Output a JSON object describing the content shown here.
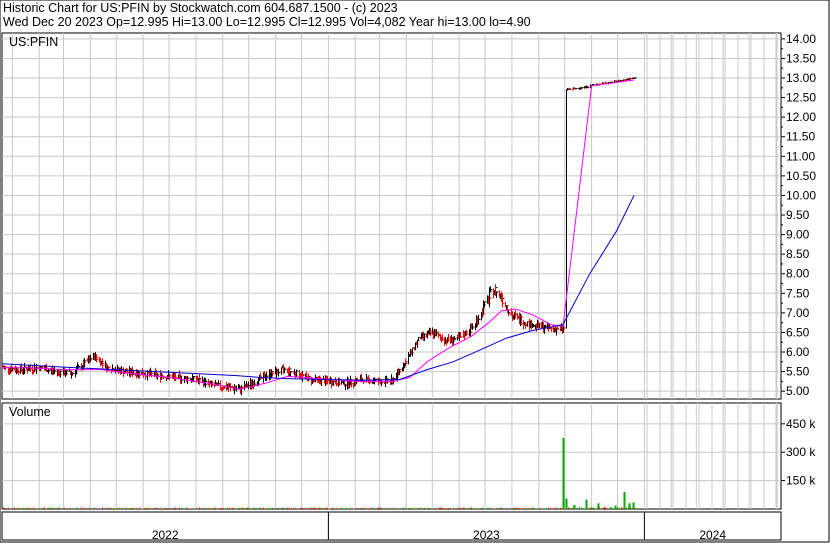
{
  "header": {
    "line1": "Historic Chart for US:PFIN by Stockwatch.com 604.687.1500 - (c) 2023",
    "line2": "Wed Dec 20 2023   Op=12.995   Hi=13.00   Lo=12.995   Cl=12.995   Vol=4,082   Year hi=13.00   lo=4.90"
  },
  "price_panel": {
    "label": "US:PFIN"
  },
  "volume_panel": {
    "label": "Volume"
  },
  "colors": {
    "up_bar": "#000000",
    "down_bar": "#ff0000",
    "short_ma": "#ff00ff",
    "long_ma": "#0000cc",
    "volume_up": "#00aa00",
    "volume_down": "#ff0000",
    "grid": "#c8c8c8",
    "axis": "#000000"
  },
  "chart_data": [
    {
      "type": "line",
      "title": "US:PFIN",
      "yaxis_ticks": [
        "14.00",
        "13.50",
        "13.00",
        "12.50",
        "12.00",
        "11.50",
        "11.00",
        "10.50",
        "10.00",
        "9.50",
        "9.00",
        "8.50",
        "8.00",
        "7.50",
        "7.00",
        "6.50",
        "6.00",
        "5.50",
        "5.00"
      ],
      "ylim": [
        4.8,
        14.15
      ],
      "xlim": [
        "2021-12-20",
        "2023-12-20"
      ],
      "x_axis_labels": [
        "2022",
        "2023",
        "2024"
      ],
      "year_boundaries": [
        "2023-01-01",
        "2024-01-01"
      ],
      "grid": true,
      "price_path": [
        [
          "2021-12-20",
          5.6
        ],
        [
          "2022-01-10",
          5.55
        ],
        [
          "2022-02-01",
          5.6
        ],
        [
          "2022-02-20",
          5.5
        ],
        [
          "2022-03-10",
          5.45
        ],
        [
          "2022-04-05",
          5.9
        ],
        [
          "2022-04-20",
          5.6
        ],
        [
          "2022-05-10",
          5.5
        ],
        [
          "2022-06-01",
          5.45
        ],
        [
          "2022-06-20",
          5.4
        ],
        [
          "2022-07-10",
          5.35
        ],
        [
          "2022-08-01",
          5.3
        ],
        [
          "2022-08-20",
          5.15
        ],
        [
          "2022-09-05",
          5.1
        ],
        [
          "2022-09-20",
          5.05
        ],
        [
          "2022-10-05",
          5.2
        ],
        [
          "2022-10-20",
          5.4
        ],
        [
          "2022-11-10",
          5.55
        ],
        [
          "2022-11-25",
          5.45
        ],
        [
          "2022-12-10",
          5.3
        ],
        [
          "2023-01-01",
          5.25
        ],
        [
          "2023-01-20",
          5.2
        ],
        [
          "2023-02-10",
          5.3
        ],
        [
          "2023-03-01",
          5.25
        ],
        [
          "2023-03-15",
          5.25
        ],
        [
          "2023-04-01",
          5.8
        ],
        [
          "2023-04-15",
          6.35
        ],
        [
          "2023-05-01",
          6.5
        ],
        [
          "2023-05-15",
          6.3
        ],
        [
          "2023-06-01",
          6.35
        ],
        [
          "2023-06-15",
          6.6
        ],
        [
          "2023-07-01",
          7.2
        ],
        [
          "2023-07-10",
          7.6
        ],
        [
          "2023-07-20",
          7.4
        ],
        [
          "2023-08-01",
          6.9
        ],
        [
          "2023-08-15",
          6.75
        ],
        [
          "2023-09-01",
          6.65
        ],
        [
          "2023-09-15",
          6.6
        ],
        [
          "2023-09-29",
          6.6
        ],
        [
          "2023-10-02",
          12.7
        ],
        [
          "2023-10-20",
          12.75
        ],
        [
          "2023-11-10",
          12.85
        ],
        [
          "2023-12-01",
          12.92
        ],
        [
          "2023-12-20",
          12.995
        ]
      ],
      "series": [
        {
          "name": "",
          "color": "#ff00ff",
          "points": [
            [
              "2021-12-20",
              5.6
            ],
            [
              "2022-01-20",
              5.6
            ],
            [
              "2022-03-01",
              5.55
            ],
            [
              "2022-04-15",
              5.55
            ],
            [
              "2022-05-20",
              5.45
            ],
            [
              "2022-07-01",
              5.35
            ],
            [
              "2022-08-15",
              5.2
            ],
            [
              "2022-09-20",
              5.05
            ],
            [
              "2022-10-20",
              5.2
            ],
            [
              "2022-11-15",
              5.38
            ],
            [
              "2022-12-20",
              5.32
            ],
            [
              "2023-02-01",
              5.25
            ],
            [
              "2023-03-15",
              5.25
            ],
            [
              "2023-04-05",
              5.35
            ],
            [
              "2023-04-25",
              5.75
            ],
            [
              "2023-05-20",
              6.1
            ],
            [
              "2023-06-15",
              6.4
            ],
            [
              "2023-07-05",
              6.75
            ],
            [
              "2023-07-20",
              7.05
            ],
            [
              "2023-08-05",
              7.1
            ],
            [
              "2023-08-25",
              6.95
            ],
            [
              "2023-09-15",
              6.7
            ],
            [
              "2023-09-29",
              6.65
            ],
            [
              "2023-11-01",
              12.8
            ],
            [
              "2023-12-20",
              12.95
            ]
          ]
        },
        {
          "name": "",
          "color": "#0000cc",
          "points": [
            [
              "2021-12-20",
              5.7
            ],
            [
              "2022-02-01",
              5.65
            ],
            [
              "2022-03-15",
              5.6
            ],
            [
              "2022-05-01",
              5.55
            ],
            [
              "2022-06-15",
              5.5
            ],
            [
              "2022-08-01",
              5.45
            ],
            [
              "2022-09-15",
              5.4
            ],
            [
              "2022-10-15",
              5.35
            ],
            [
              "2022-11-15",
              5.32
            ],
            [
              "2022-12-20",
              5.3
            ],
            [
              "2023-02-15",
              5.28
            ],
            [
              "2023-03-25",
              5.3
            ],
            [
              "2023-04-25",
              5.55
            ],
            [
              "2023-05-25",
              5.75
            ],
            [
              "2023-06-25",
              6.05
            ],
            [
              "2023-07-25",
              6.35
            ],
            [
              "2023-08-25",
              6.55
            ],
            [
              "2023-09-29",
              6.7
            ],
            [
              "2023-10-30",
              8.0
            ],
            [
              "2023-11-30",
              9.1
            ],
            [
              "2023-12-20",
              10.0
            ]
          ]
        }
      ]
    },
    {
      "type": "bar",
      "title": "Volume",
      "yaxis_ticks": [
        "450 k",
        "300 k",
        "150 k"
      ],
      "ylim": [
        0,
        560
      ],
      "spikes": [
        [
          "2023-09-29",
          375
        ],
        [
          "2023-10-03",
          55
        ],
        [
          "2023-10-12",
          22
        ],
        [
          "2023-10-25",
          50
        ],
        [
          "2023-11-08",
          30
        ],
        [
          "2023-11-28",
          18
        ],
        [
          "2023-12-08",
          90
        ],
        [
          "2023-12-14",
          30
        ],
        [
          "2023-12-19",
          35
        ]
      ]
    }
  ]
}
